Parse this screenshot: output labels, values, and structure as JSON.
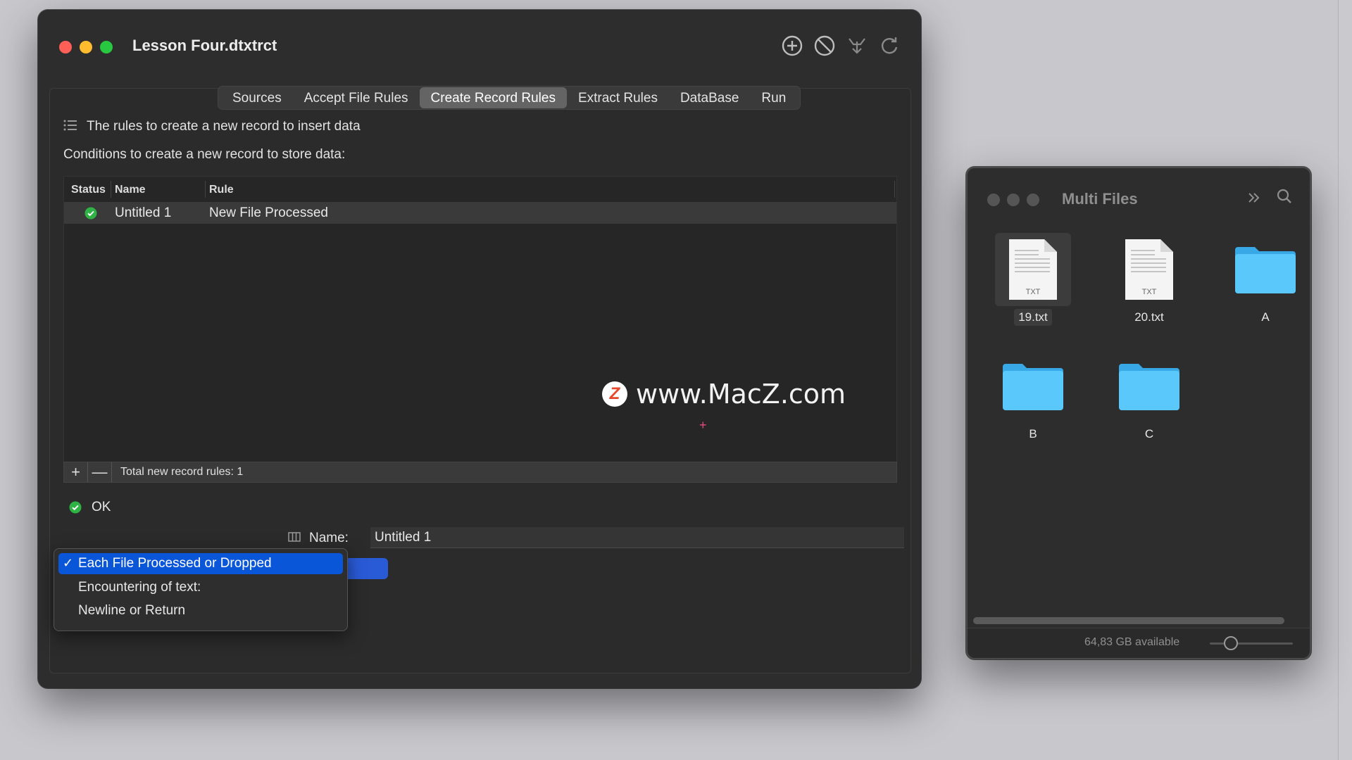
{
  "main_window": {
    "title": "Lesson Four.dtxtrct",
    "toolbar_icons": [
      "add-circle-icon",
      "prohibit-icon",
      "filter-down-icon",
      "refresh-icon"
    ],
    "tabs": [
      {
        "label": "Sources",
        "active": false
      },
      {
        "label": "Accept File Rules",
        "active": false
      },
      {
        "label": "Create Record Rules",
        "active": true
      },
      {
        "label": "Extract Rules",
        "active": false
      },
      {
        "label": "DataBase",
        "active": false
      },
      {
        "label": "Run",
        "active": false
      }
    ],
    "description": "The rules to create a new record to insert data",
    "conditions_label": "Conditions to create a new record to store data:",
    "table": {
      "columns": [
        "Status",
        "Name",
        "Rule"
      ],
      "rows": [
        {
          "status": "ok",
          "name": "Untitled 1",
          "rule": "New File Processed"
        }
      ],
      "footer": {
        "add": "+",
        "remove": "—",
        "summary": "Total new record rules: 1"
      }
    },
    "status": {
      "text": "OK"
    },
    "name_field": {
      "label": "Name:",
      "value": "Untitled 1"
    },
    "trigger_menu": {
      "options": [
        {
          "label": "Each File Processed or Dropped",
          "selected": true
        },
        {
          "label": "Encountering of text:",
          "selected": false
        },
        {
          "label": "Newline or Return",
          "selected": false
        }
      ],
      "checkmark": "✓"
    },
    "watermark": {
      "logo_letter": "Z",
      "text": "www.MacZ.com"
    },
    "cursor_mark": "+"
  },
  "multi_files_window": {
    "title": "Multi Files",
    "items": [
      {
        "name": "19.txt",
        "kind": "txt",
        "badge": "TXT",
        "selected": true
      },
      {
        "name": "20.txt",
        "kind": "txt",
        "badge": "TXT",
        "selected": false
      },
      {
        "name": "A",
        "kind": "folder",
        "selected": false
      },
      {
        "name": "B",
        "kind": "folder",
        "selected": false
      },
      {
        "name": "C",
        "kind": "folder",
        "selected": false
      }
    ],
    "available_space": "64,83 GB available",
    "zoom_fraction": 0.25
  },
  "colors": {
    "accent": "#0a56d9",
    "status_ok": "#2fb344",
    "folder_blue": "#5ac8fa",
    "watermark_logo": "#e8472b"
  }
}
